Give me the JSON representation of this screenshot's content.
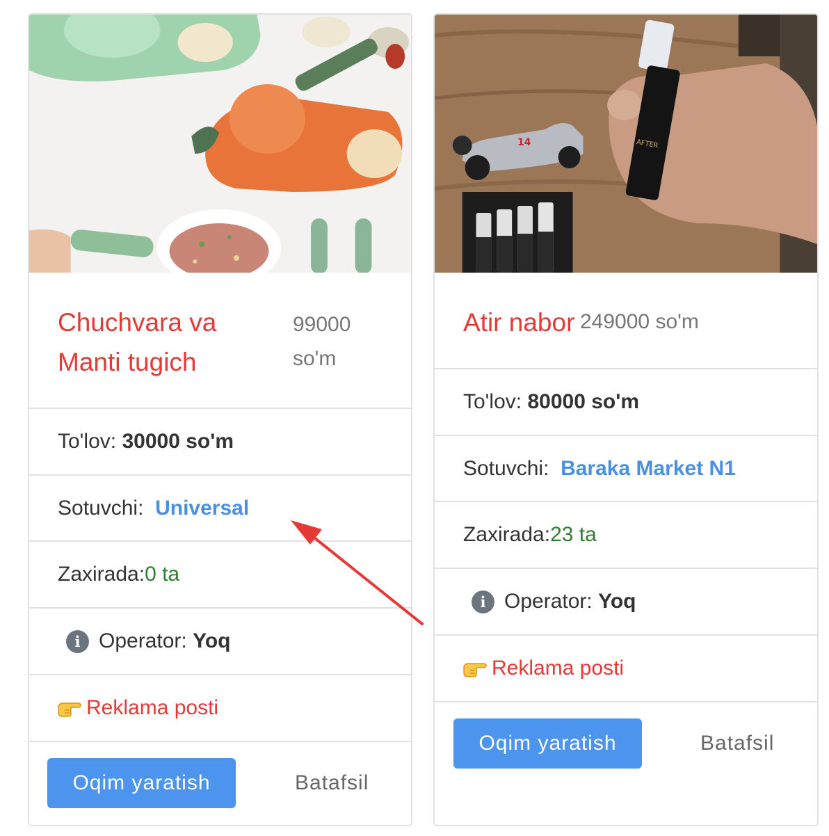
{
  "products": [
    {
      "title": "Chuchvara va Manti tugich",
      "title_line1": "Chuchvara va",
      "title_line2": "Manti tugich",
      "price_line1": "99000",
      "price_line2": "so'm",
      "payment_label": "To'lov:",
      "payment_value": "30000 so'm",
      "seller_label": "Sotuvchi:",
      "seller_value": "Universal",
      "stock_label": "Zaxirada:",
      "stock_value": "0 ta",
      "operator_label": "Operator:",
      "operator_value": "Yoq",
      "ad_label": "Reklama posti",
      "create_button": "Oqim yaratish",
      "details_link": "Batafsil",
      "image_icon": "dumpling-maker-photo"
    },
    {
      "title": "Atir nabor",
      "price": "249000 so'm",
      "payment_label": "To'lov:",
      "payment_value": "80000 so'm",
      "seller_label": "Sotuvchi:",
      "seller_value": "Baraka Market N1",
      "stock_label": "Zaxirada:",
      "stock_value": "23 ta",
      "operator_label": "Operator:",
      "operator_value": "Yoq",
      "ad_label": "Reklama posti",
      "create_button": "Oqim yaratish",
      "details_link": "Batafsil",
      "image_icon": "perfume-set-photo"
    }
  ],
  "colors": {
    "title": "#e53935",
    "seller": "#4a90e2",
    "stock": "#2e7d32",
    "button": "#4c94ee",
    "annotation_arrow": "#e53935"
  },
  "icons": {
    "operator": "info-circle-icon",
    "ad": "pointing-hand-icon"
  }
}
